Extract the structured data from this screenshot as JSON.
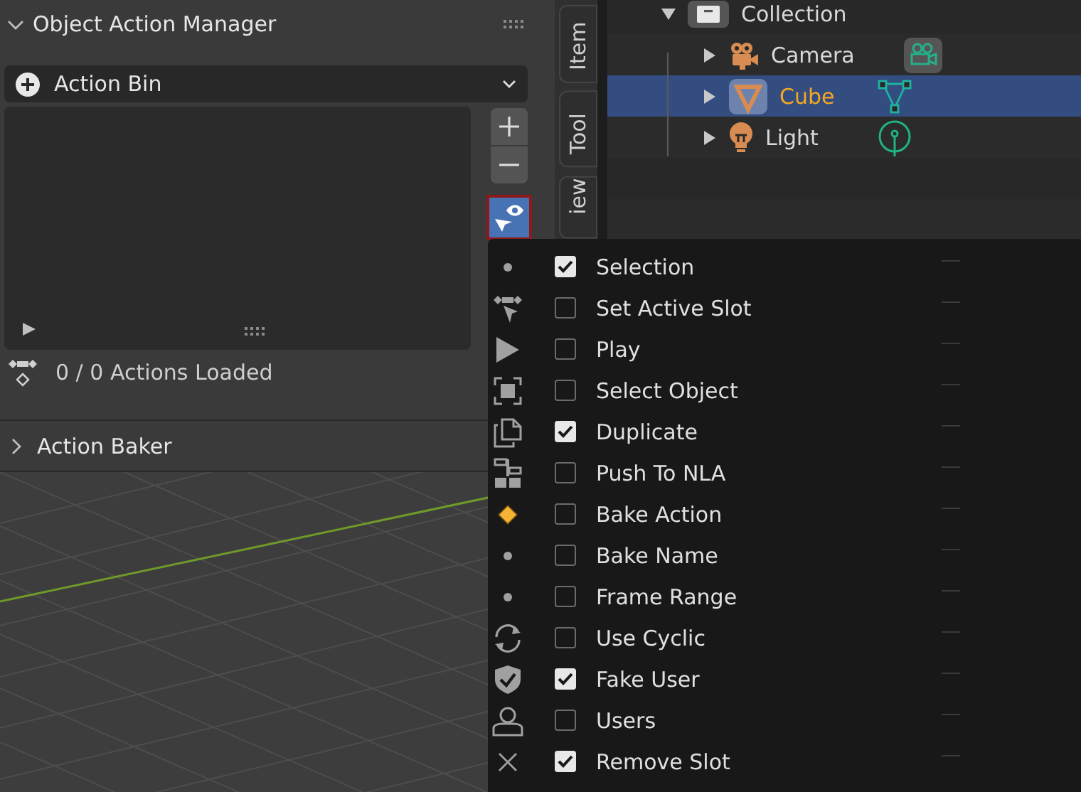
{
  "panel": {
    "title": "Object Action Manager",
    "expanded": true,
    "dropdown": {
      "label": "Action Bin"
    },
    "status": "0 / 0 Actions Loaded"
  },
  "filter": {
    "active": true
  },
  "sections": [
    {
      "title": "Action Baker",
      "expanded": false
    }
  ],
  "tabs": [
    {
      "label": "Item",
      "selected": false
    },
    {
      "label": "Tool",
      "selected": false
    },
    {
      "label": "iew",
      "selected": false
    }
  ],
  "outliner": {
    "items": [
      {
        "label": "Collection",
        "kind": "collection",
        "expanded": true,
        "selected": false,
        "children": [
          {
            "label": "Camera",
            "kind": "camera",
            "expanded": false,
            "selected": false
          },
          {
            "label": "Cube",
            "kind": "mesh",
            "expanded": false,
            "selected": true
          },
          {
            "label": "Light",
            "kind": "light",
            "expanded": false,
            "selected": false
          }
        ]
      }
    ]
  },
  "menu": {
    "items": [
      {
        "kind": "dot",
        "label": "Selection",
        "checked": true
      },
      {
        "kind": "pointer",
        "label": "Set Active Slot",
        "checked": false
      },
      {
        "kind": "play",
        "label": "Play",
        "checked": false
      },
      {
        "kind": "select",
        "label": "Select Object",
        "checked": false
      },
      {
        "kind": "duplicate",
        "label": "Duplicate",
        "checked": true
      },
      {
        "kind": "push",
        "label": "Push To NLA",
        "checked": false
      },
      {
        "kind": "diamond",
        "label": "Bake Action",
        "checked": false
      },
      {
        "kind": "dot",
        "label": "Bake Name",
        "checked": false
      },
      {
        "kind": "dot",
        "label": "Frame Range",
        "checked": false
      },
      {
        "kind": "cycle",
        "label": "Use Cyclic",
        "checked": false
      },
      {
        "kind": "shield",
        "label": "Fake User",
        "checked": true
      },
      {
        "kind": "user",
        "label": "Users",
        "checked": false
      },
      {
        "kind": "close",
        "label": "Remove Slot",
        "checked": true
      }
    ]
  }
}
